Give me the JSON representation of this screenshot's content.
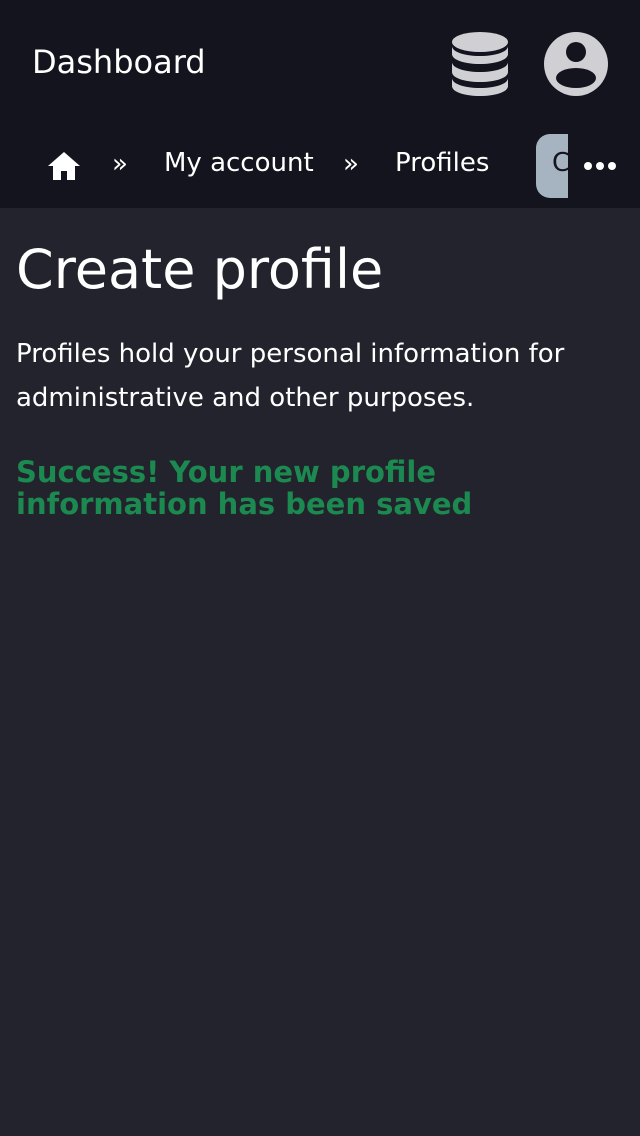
{
  "header": {
    "title": "Dashboard",
    "database_icon": "database-icon",
    "avatar_icon": "user-avatar-icon"
  },
  "breadcrumb": {
    "home_icon": "home-icon",
    "separator": "»",
    "items": [
      {
        "label": "My account"
      },
      {
        "label": "Profiles"
      }
    ],
    "current": "Create profile",
    "more_icon": "more-horizontal-icon"
  },
  "main": {
    "title": "Create profile",
    "description": "Profiles hold your personal information for administrative and other purposes.",
    "success_message": "Success! Your new profile information has been saved"
  },
  "colors": {
    "topbar_bg": "#13141d",
    "page_bg": "#22232c",
    "success": "#1c8a50",
    "current_crumb_bg": "#a6b3c1",
    "icon_gray": "#d0d0d4"
  }
}
